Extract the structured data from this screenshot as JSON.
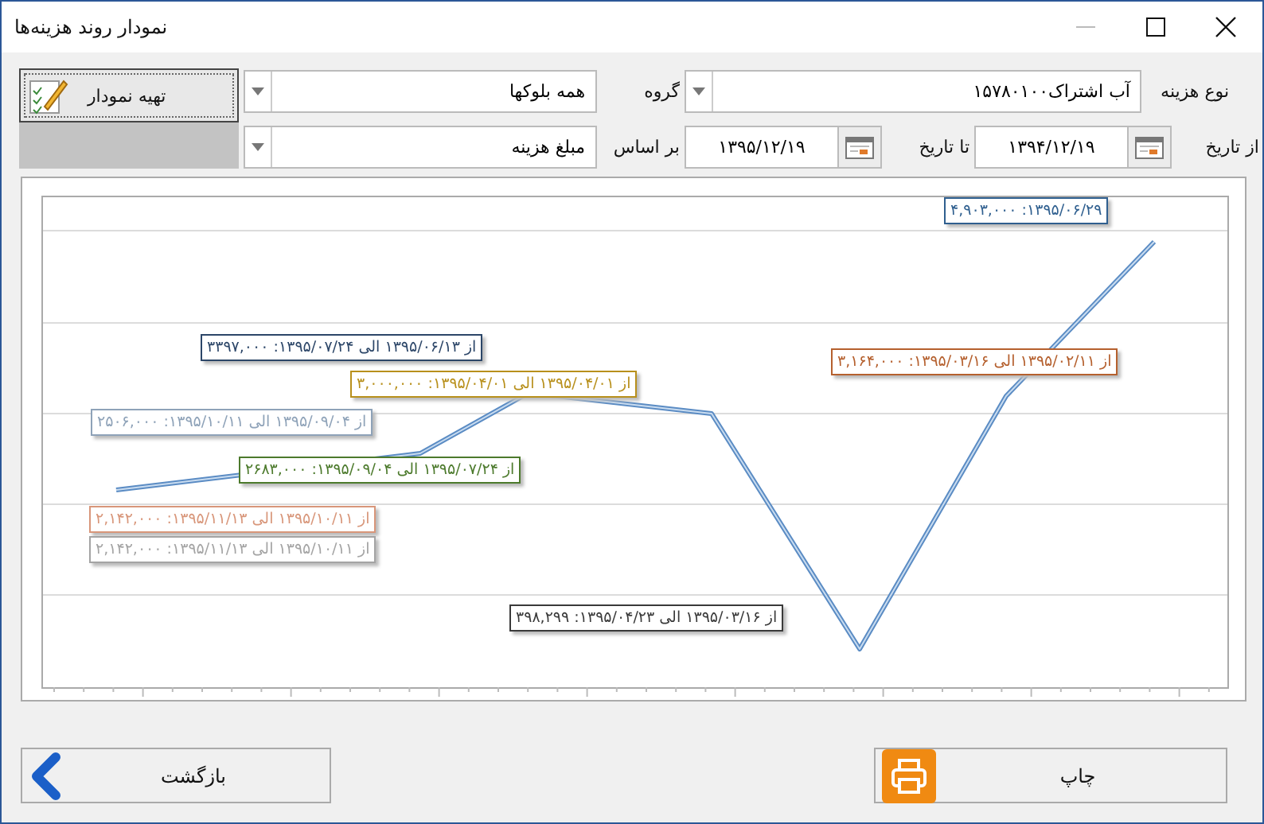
{
  "window": {
    "title": "نمودار روند هزینه‌ها"
  },
  "filters": {
    "cost_type": {
      "label": "نوع هزینه",
      "value": "آب اشتراک۱۵۷۸۰۱۰۰"
    },
    "from_date": {
      "label": "از تاریخ",
      "value": "۱۳۹۴/۱۲/۱۹"
    },
    "to_date": {
      "label": "تا تاریخ",
      "value": "۱۳۹۵/۱۲/۱۹"
    },
    "group": {
      "label": "گروه",
      "value": "همه بلوکها"
    },
    "basis": {
      "label": "بر اساس",
      "value": "مبلغ هزینه"
    }
  },
  "build_button": {
    "label": "تهیه نمودار"
  },
  "chart": {
    "labels": [
      {
        "text": "۱۳۹۵/۰۶/۲۹: ۴,۹۰۳,۰۰۰",
        "color": "#2f5f8f"
      },
      {
        "text": "از ۱۳۹۵/۰۲/۱۱ الی ۱۳۹۵/۰۳/۱۶: ۳,۱۶۴,۰۰۰",
        "color": "#b5602e"
      },
      {
        "text": "از ۱۳۹۵/۰۶/۱۳ الی ۱۳۹۵/۰۷/۲۴: ۳۳۹۷,۰۰۰",
        "color": "#2c4668"
      },
      {
        "text": "از ۱۳۹۵/۰۴/۰۱ الی ۱۳۹۵/۰۴/۰۱: ۳,۰۰۰,۰۰۰",
        "color": "#b8901c"
      },
      {
        "text": "از ۱۳۹۵/۰۹/۰۴ الی ۱۳۹۵/۱۰/۱۱: ۲۵۰۶,۰۰۰",
        "color": "#8ea2b8"
      },
      {
        "text": "از ۱۳۹۵/۰۷/۲۴ الی ۱۳۹۵/۰۹/۰۴: ۲۶۸۳,۰۰۰",
        "color": "#4c7a2c"
      },
      {
        "text": "از ۱۳۹۵/۱۰/۱۱ الی ۱۳۹۵/۱۱/۱۳: ۲,۱۴۲,۰۰۰",
        "color": "#d8967a"
      },
      {
        "text": "از ۱۳۹۵/۱۰/۱۱ الی ۱۳۹۵/۱۱/۱۳: ۲,۱۴۲,۰۰۰",
        "color": "#a4a4a4"
      },
      {
        "text": "از ۱۳۹۵/۰۳/۱۶ الی ۱۳۹۵/۰۴/۲۳: ۳۹۸,۲۹۹",
        "color": "#3a3a3a"
      }
    ]
  },
  "buttons": [
    {
      "label": "چاپ",
      "kind": "print"
    },
    {
      "label": "بازگشت",
      "kind": "back"
    }
  ]
}
